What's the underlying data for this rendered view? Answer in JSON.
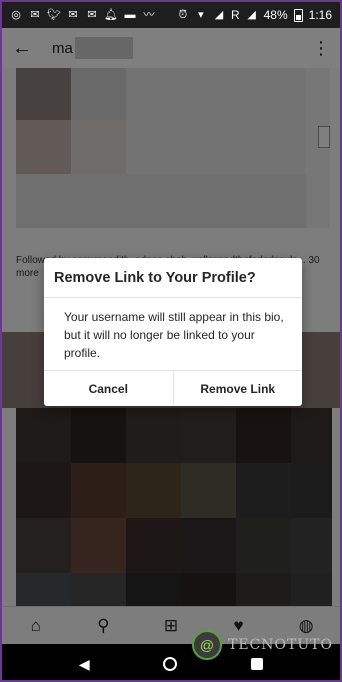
{
  "status_bar": {
    "battery": "48%",
    "time": "1:16",
    "network_letter": "R",
    "icons_left": [
      "whatsapp-icon",
      "email-icon",
      "twitter-icon",
      "email-icon",
      "email-icon",
      "notification-icon",
      "messages-icon",
      "mustache-icon"
    ],
    "icons_right": [
      "alarm-icon",
      "wifi-icon",
      "signal-icon",
      "battery-icon"
    ]
  },
  "header": {
    "title_prefix": "ma",
    "back_icon": "arrow-left-icon",
    "overflow_icon": "more-vertical-icon"
  },
  "profile": {
    "followed_by_text": "Followed by samupandith, adnan.shah, valleyandthefadedsouls... 30 more"
  },
  "dialog": {
    "title": "Remove Link to Your Profile?",
    "body": "Your username will still appear in this bio, but it will no longer be linked to your profile.",
    "cancel_label": "Cancel",
    "confirm_label": "Remove Link"
  },
  "bottom_nav": [
    "home-icon",
    "search-icon",
    "add-post-icon",
    "activity-heart-icon",
    "profile-icon"
  ],
  "watermark": {
    "text": "TECNOTUTO"
  }
}
